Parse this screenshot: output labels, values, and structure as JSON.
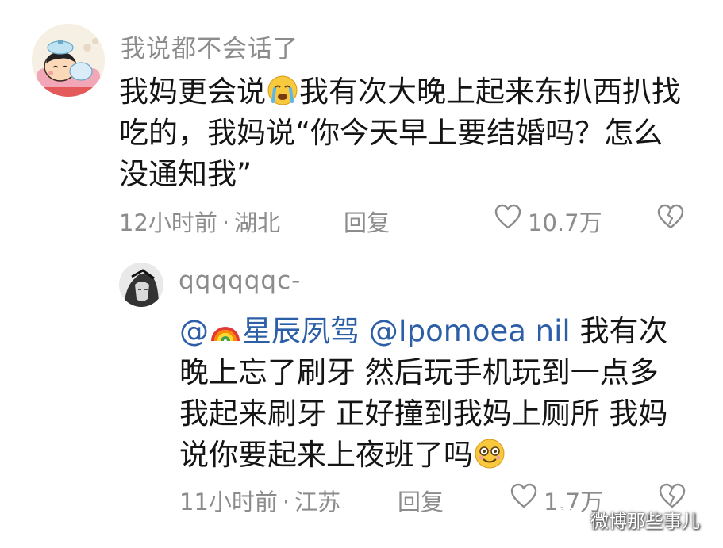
{
  "comment": {
    "username": "我说都不会话了",
    "text_part1": "我妈更会说",
    "text_part2": "我有次大晚上起来东扒西扒找吃的，我妈说“你今天早上要结婚吗？怎么没通知我”",
    "emoji": "crying-face",
    "time": "12小时前",
    "separator": "·",
    "location": "湖北",
    "reply_label": "回复",
    "likes": "10.7万"
  },
  "reply": {
    "username": "qqqqqqc-",
    "mention_prefix": "@",
    "mention_emoji": "rainbow",
    "mention1": "星辰夙驾",
    "mention2": "@Ipomoea nil",
    "text": " 我有次晚上忘了刷牙 然后玩手机玩到一点多 我起来刷牙 正好撞到我妈上厕所 我妈说你要起来上夜班了吗",
    "emoji": "dizzy-eyes-face",
    "time": "11小时前",
    "separator": "·",
    "location": "江苏",
    "reply_label": "回复",
    "likes": "1.7万"
  },
  "watermark": {
    "text": "微博那些事儿",
    "icon": "wechat-icon"
  },
  "colors": {
    "text": "#141414",
    "secondary": "#8c8c8c",
    "mention": "#2d5fa8",
    "background": "#ffffff"
  }
}
